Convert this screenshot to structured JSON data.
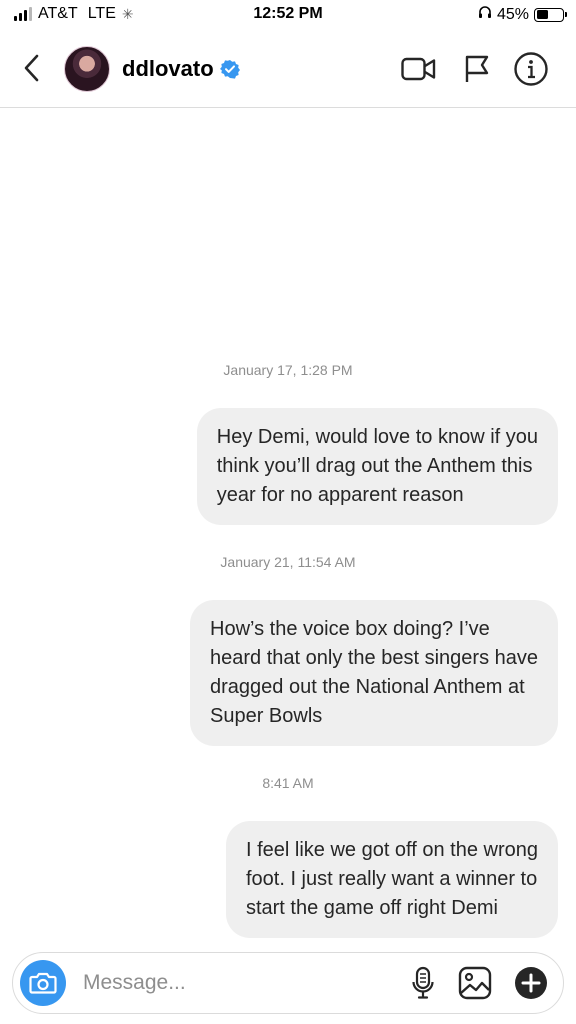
{
  "status_bar": {
    "carrier": "AT&T",
    "network": "LTE",
    "time": "12:52 PM",
    "battery": "45%",
    "battery_level": 0.45
  },
  "header": {
    "username": "ddlovato",
    "verified": true,
    "icons": [
      "back-icon",
      "video-call-icon",
      "flag-icon",
      "info-icon"
    ]
  },
  "messages": [
    {
      "timestamp": "January 17, 1:28 PM",
      "lines": [
        "Hey Demi, would love to know if you",
        "think you’ll drag out the Anthem this",
        "year for no apparent reason"
      ]
    },
    {
      "timestamp": "January 21, 11:54 AM",
      "lines": [
        "How’s the voice box doing? I’ve",
        "heard that only the best singers have",
        "dragged out the National Anthem at",
        "Super Bowls"
      ]
    },
    {
      "timestamp": "8:41 AM",
      "lines": [
        "I feel like we got off on the wrong",
        "foot. I just really want a winner to",
        "start the game off right Demi"
      ]
    }
  ],
  "composer": {
    "placeholder": "Message...",
    "value": ""
  },
  "colors": {
    "accent": "#3797f0",
    "bubble": "#efefef",
    "timestamp": "#8e8e8e"
  }
}
